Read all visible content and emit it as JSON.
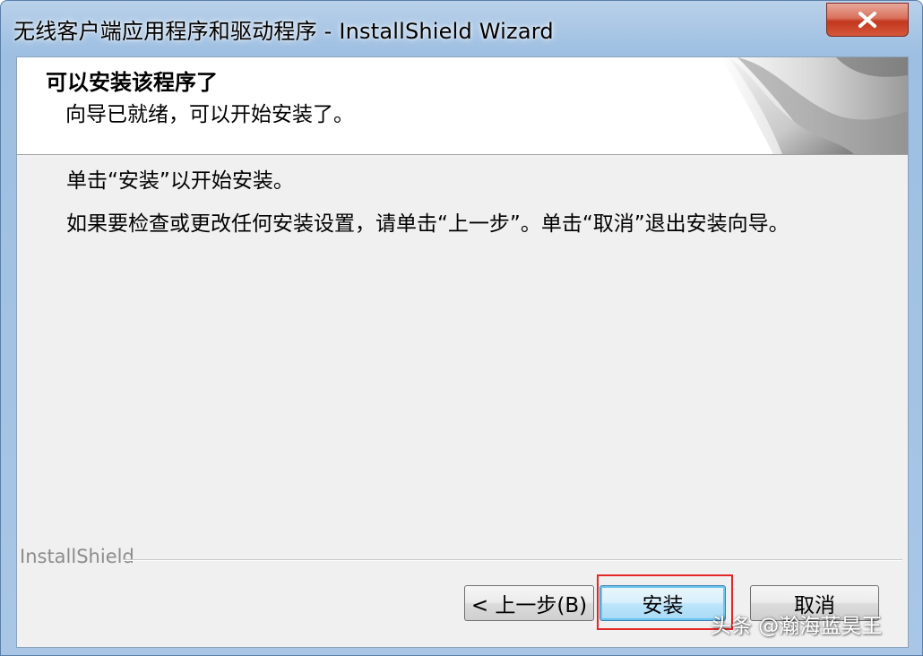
{
  "window": {
    "title": "无线客户端应用程序和驱动程序 - InstallShield Wizard",
    "close_icon": "close-icon"
  },
  "header": {
    "title": "可以安装该程序了",
    "subtitle": "向导已就绪，可以开始安装了。",
    "art_icon": "page-curl-icon"
  },
  "body": {
    "line1": "单击“安装”以开始安装。",
    "line2": "如果要检查或更改任何安装设置，请单击“上一步”。单击“取消”退出安装向导。"
  },
  "footer": {
    "brand": "InstallShield"
  },
  "buttons": {
    "back": "< 上一步(B)",
    "install": "安装",
    "cancel": "取消"
  },
  "watermark": "头条 @瀚海蓝昊王",
  "colors": {
    "highlight": "#e32626",
    "close_button": "#c2381e",
    "default_button_border": "#3c7fb1"
  }
}
